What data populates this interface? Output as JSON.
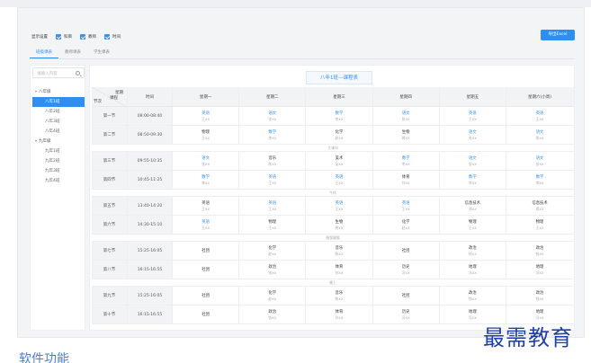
{
  "settings": {
    "label": "显示设置",
    "options": [
      "科目",
      "教师",
      "时间"
    ]
  },
  "export_label": "导出Excel",
  "tabs": [
    "班级课表",
    "教师课表",
    "学生课表"
  ],
  "sidebar": {
    "search_placeholder": "请输入内容",
    "groups": [
      {
        "label": "八年级",
        "children": [
          "八年1班",
          "八年2班",
          "八年3班",
          "八年4班"
        ]
      },
      {
        "label": "九年级",
        "children": [
          "九年1班",
          "九年2班",
          "九年3班",
          "九年4班"
        ]
      }
    ],
    "selected": "八年1班"
  },
  "table": {
    "title": "八年1班—课程表",
    "corner": {
      "top": "星期",
      "mid": "课程",
      "bottom": "节次"
    },
    "time_header": "时间",
    "days": [
      "星期一",
      "星期二",
      "星期三",
      "星期四",
      "星期五",
      "星期六(小周)"
    ],
    "rows": [
      {
        "type": "row",
        "period": "第一节",
        "time": "08:00-08:40",
        "cells": [
          [
            "英语",
            "王XX",
            1
          ],
          [
            "语文",
            "张XX",
            1
          ],
          [
            "数学",
            "李XX",
            1
          ],
          [
            "语文",
            "张XX",
            1
          ],
          [
            "英语",
            "王XX",
            1
          ],
          [
            "英语",
            "王XX",
            1
          ]
        ]
      },
      {
        "type": "row",
        "period": "第二节",
        "time": "08:50-09:30",
        "cells": [
          [
            "物理",
            "王XX",
            0
          ],
          [
            "数学",
            "李XX",
            1
          ],
          [
            "化学",
            "赵XX",
            0
          ],
          [
            "生物",
            "周XX",
            0
          ],
          [
            "语文",
            "张XX",
            1
          ],
          [
            "语文",
            "张XX",
            1
          ]
        ]
      },
      {
        "type": "sep",
        "label": "大课间"
      },
      {
        "type": "row",
        "period": "第三节",
        "time": "09:55-10:35",
        "cells": [
          [
            "语文",
            "张XX",
            1
          ],
          [
            "音乐",
            "陈XX",
            0
          ],
          [
            "美术",
            "吴XX",
            0
          ],
          [
            "数学",
            "李XX",
            1
          ],
          [
            "语文",
            "张XX",
            1
          ],
          [
            "语文",
            "张XX",
            1
          ]
        ]
      },
      {
        "type": "row",
        "period": "第四节",
        "time": "10:45-11:25",
        "cells": [
          [
            "数学",
            "李XX",
            1
          ],
          [
            "英语",
            "王XX",
            1
          ],
          [
            "英语",
            "王XX",
            1
          ],
          [
            "体育",
            "孙XX",
            0
          ],
          [
            "数学",
            "李XX",
            1
          ],
          [
            "数学",
            "李XX",
            1
          ]
        ]
      },
      {
        "type": "sep",
        "label": "午休"
      },
      {
        "type": "row",
        "period": "第五节",
        "time": "13:40-14:20",
        "cells": [
          [
            "英语",
            "王XX",
            0
          ],
          [
            "英语",
            "王XX",
            1
          ],
          [
            "英语",
            "王XX",
            1
          ],
          [
            "英语",
            "王XX",
            1
          ],
          [
            "信息技术",
            "郑XX",
            0
          ],
          [
            "信息技术",
            "郑XX",
            0
          ]
        ]
      },
      {
        "type": "row",
        "period": "第六节",
        "time": "14:30-15:10",
        "cells": [
          [
            "英语",
            "王XX",
            1
          ],
          [
            "物理",
            "王XX",
            0
          ],
          [
            "生物",
            "周XX",
            0
          ],
          [
            "化学",
            "赵XX",
            0
          ],
          [
            "物理",
            "王XX",
            0
          ],
          [
            "物理",
            "王XX",
            0
          ]
        ]
      },
      {
        "type": "sep",
        "label": "眼保健操"
      },
      {
        "type": "row",
        "period": "第七节",
        "time": "15:25-16:05",
        "cells": [
          [
            "社团",
            "",
            0
          ],
          [
            "化学",
            "赵XX",
            0
          ],
          [
            "音乐",
            "陈XX",
            0
          ],
          [
            "社团",
            "",
            0
          ],
          [
            "政治",
            "钱XX",
            0
          ],
          [
            "政治",
            "钱XX",
            0
          ]
        ]
      },
      {
        "type": "row",
        "period": "第八节",
        "time": "16:15-16:55",
        "cells": [
          [
            "社团",
            "",
            0
          ],
          [
            "政治",
            "钱XX",
            0
          ],
          [
            "体育",
            "孙XX",
            0
          ],
          [
            "历史",
            "冯XX",
            0
          ],
          [
            "地理",
            "冯XX",
            0
          ],
          [
            "地理",
            "冯XX",
            0
          ]
        ]
      },
      {
        "type": "sep",
        "label": "晚上"
      },
      {
        "type": "row",
        "period": "第九节",
        "time": "15:25-16:05",
        "cells": [
          [
            "社团",
            "",
            0
          ],
          [
            "化学",
            "赵XX",
            0
          ],
          [
            "音乐",
            "陈XX",
            0
          ],
          [
            "社团",
            "",
            0
          ],
          [
            "政治",
            "钱XX",
            0
          ],
          [
            "政治",
            "钱XX",
            0
          ]
        ]
      },
      {
        "type": "row",
        "period": "第十节",
        "time": "16:15-16:55",
        "cells": [
          [
            "社团",
            "",
            0
          ],
          [
            "政治",
            "钱XX",
            0
          ],
          [
            "体育",
            "孙XX",
            0
          ],
          [
            "历史",
            "冯XX",
            0
          ],
          [
            "地理",
            "冯XX",
            0
          ],
          [
            "地理",
            "冯XX",
            0
          ]
        ]
      }
    ]
  },
  "watermark": "最需教育",
  "bottom_link": "软件功能",
  "colors": {
    "accent": "#2f8ef4",
    "watermark": "#1e3ea8"
  }
}
